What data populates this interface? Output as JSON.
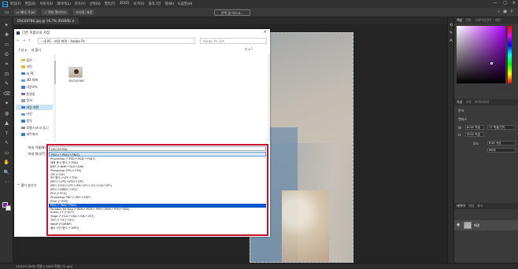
{
  "app": {
    "menu": [
      "파일(F)",
      "편집(E)",
      "이미지(I)",
      "레이어(L)",
      "문자(Y)",
      "선택(S)",
      "필터(T)",
      "3D(D)",
      "보기(V)",
      "플러그인",
      "창(W)",
      "도움말(H)"
    ],
    "window_controls": [
      "—",
      "▢",
      "✕"
    ],
    "options": [
      "▭ 페더: 0 px",
      "✓ 앤티 앨리어스",
      "스타일: 표준"
    ],
    "select_mask": "선택 및 마스크...",
    "document_tab": "DSC09786.jpg @ 16.7% (RGB/8) ✕",
    "status": "16.67%   6000 픽셀 x 4000 픽셀 (72 ppi)"
  },
  "toolbar": {
    "tools": [
      "▸",
      "✥",
      "▭",
      "ʘ",
      "⌗",
      "⊡",
      "✎",
      "⌫",
      "✦",
      "◍",
      "▲",
      "ᴛ",
      "↖",
      "▭",
      "✋",
      "🔍",
      "⋯"
    ]
  },
  "panels": {
    "color_tabs": [
      "색상",
      "견본",
      "그레이디언트",
      "패턴"
    ],
    "property_tabs": [
      "속성",
      "조정",
      "라이브러리"
    ],
    "doc_label": "문서",
    "canvas_label": "캔버스",
    "width_label": "W",
    "width_value": "6000 픽셀",
    "height_label": "H",
    "height_value": "4000 픽셀",
    "resolution_value": "72 픽셀/인치",
    "mode_label": "모드",
    "mode_value": "RGB 색상",
    "bit_value": "8비트",
    "layer_tabs": [
      "레이어",
      "채널",
      "패스"
    ],
    "layer_name": "배경"
  },
  "dialog": {
    "title": "다른 이름으로 저장",
    "close": "✕",
    "address": "› 내 PC › 바탕 화면 › Adobe Ps",
    "search_placeholder": "Adobe Ps 검색",
    "commands": [
      "구성 ▾",
      "새 폴더"
    ],
    "nav": [
      {
        "label": "음악",
        "color": "#e8b44a"
      },
      {
        "label": "사진",
        "color": "#e8b44a"
      },
      {
        "label": "내 PC",
        "color": "#3c7fc4"
      },
      {
        "label": "3D 개체",
        "color": "#5aa0dd"
      },
      {
        "label": "다운로드",
        "color": "#3c7fc4"
      },
      {
        "label": "동영상",
        "color": "#7a5fb0"
      },
      {
        "label": "문서",
        "color": "#8aa1bd"
      },
      {
        "label": "바탕 화면",
        "color": "#3c7fc4"
      },
      {
        "label": "사진",
        "color": "#5aa0dd"
      },
      {
        "label": "음악",
        "color": "#3c7fc4"
      },
      {
        "label": "로컬 디스크 (C:)",
        "color": "#7f8c99"
      },
      {
        "label": "네트워크",
        "color": "#3c7fc4"
      }
    ],
    "file_name": "DSC09786",
    "filename_label": "파일 이름(N):",
    "filetype_label": "파일 형식(T):",
    "hide_folders": "^ 폴더 숨기기",
    "filename_value": "DSC09786",
    "filetype_selected": "PNG (*.PNG;*.PNG)",
    "filetype_options": [
      "Photoshop (*.PSD;*.PDD;*.PSDT)",
      "대형 문서 형식 (*.PSB)",
      "BMP (*.BMP;*.RLE;*.DIB)",
      "Photoshop EPS (*.EPS)",
      "GIF (*.GIF)",
      "IFF 형식 (*.IFF;*.TDI)",
      "JPEG (*.JPG;*.JPEG;*.JPE)",
      "JPEG 2000 (*.JPF;*.JPX;*.JP2;*.J2C;*.J2K;*.JPC)",
      "JPEG 스테레오 (*.JPS)",
      "PCX (*.PCX)",
      "Photoshop PDF (*.PDF;*.PDP)",
      "Pixar (*.PXR)",
      "PNG (*.PNG;*.PNG)",
      "Portable Bit Map (*.PBM;*.PGM;*.PPM;*.PNM;*.PFM;*.PAM)",
      "Scitex CT (*.SCT)",
      "Targa (*.TGA;*.VDA;*.ICB;*.VST)",
      "TIFF (*.TIF;*.TIFF)",
      "WebP (*.WEBP)",
      "멀티 사진 형식 (*.MPO)"
    ],
    "filetype_selected_index": 12
  }
}
